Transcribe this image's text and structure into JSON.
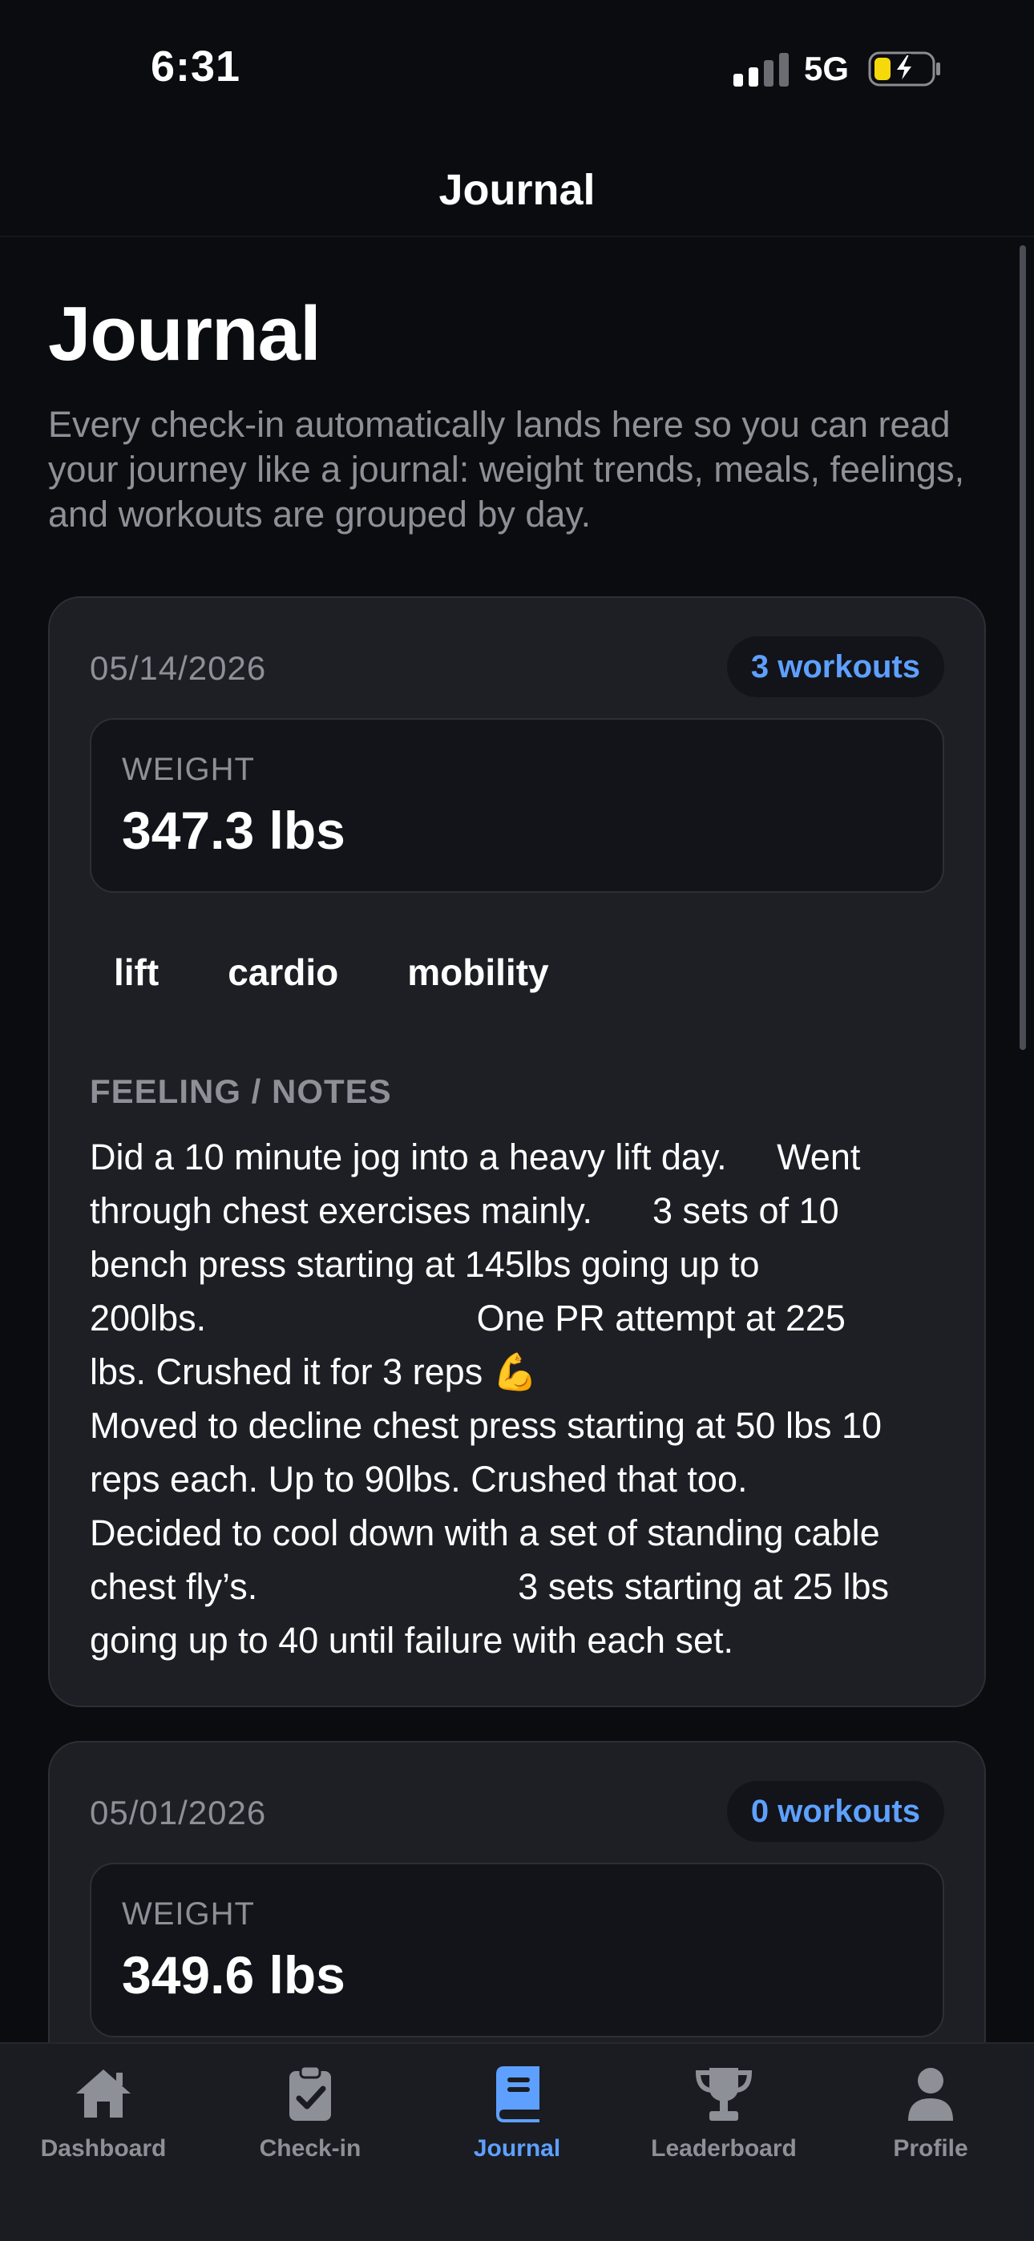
{
  "status_bar": {
    "time": "6:31",
    "network": "5G"
  },
  "nav": {
    "title": "Journal"
  },
  "page": {
    "title": "Journal",
    "description": "Every check-in automatically lands here so you can read your journey like a journal: weight trends, meals, feelings, and workouts are grouped by day."
  },
  "entries": [
    {
      "date": "05/14/2026",
      "workouts": "3 workouts",
      "weight_label": "WEIGHT",
      "weight": "347.3 lbs",
      "tags": [
        "lift",
        "cardio",
        "mobility"
      ],
      "notes_label": "FEELING / NOTES",
      "notes": "Did a 10 minute jog into a heavy lift day.     Went\nthrough chest exercises mainly.      3 sets of 10\nbench press starting at 145lbs going up to\n200lbs.                           One PR attempt at 225\nlbs. Crushed it for 3 reps 💪\nMoved to decline chest press starting at 50 lbs 10\nreps each. Up to 90lbs. Crushed that too.\nDecided to cool down with a set of standing cable\nchest fly’s.                          3 sets starting at 25 lbs\ngoing up to 40 until failure with each set."
    },
    {
      "date": "05/01/2026",
      "workouts": "0 workouts",
      "weight_label": "WEIGHT",
      "weight": "349.6 lbs"
    }
  ],
  "tab_bar": {
    "tabs": [
      {
        "label": "Dashboard",
        "icon": "home-icon"
      },
      {
        "label": "Check-in",
        "icon": "clipboard-check-icon"
      },
      {
        "label": "Journal",
        "icon": "book-icon",
        "active": true
      },
      {
        "label": "Leaderboard",
        "icon": "trophy-icon"
      },
      {
        "label": "Profile",
        "icon": "person-icon"
      }
    ]
  },
  "colors": {
    "accent": "#5ea0ff",
    "background": "#0b0c0f",
    "card": "#1d1f25",
    "muted": "#8e9098"
  }
}
